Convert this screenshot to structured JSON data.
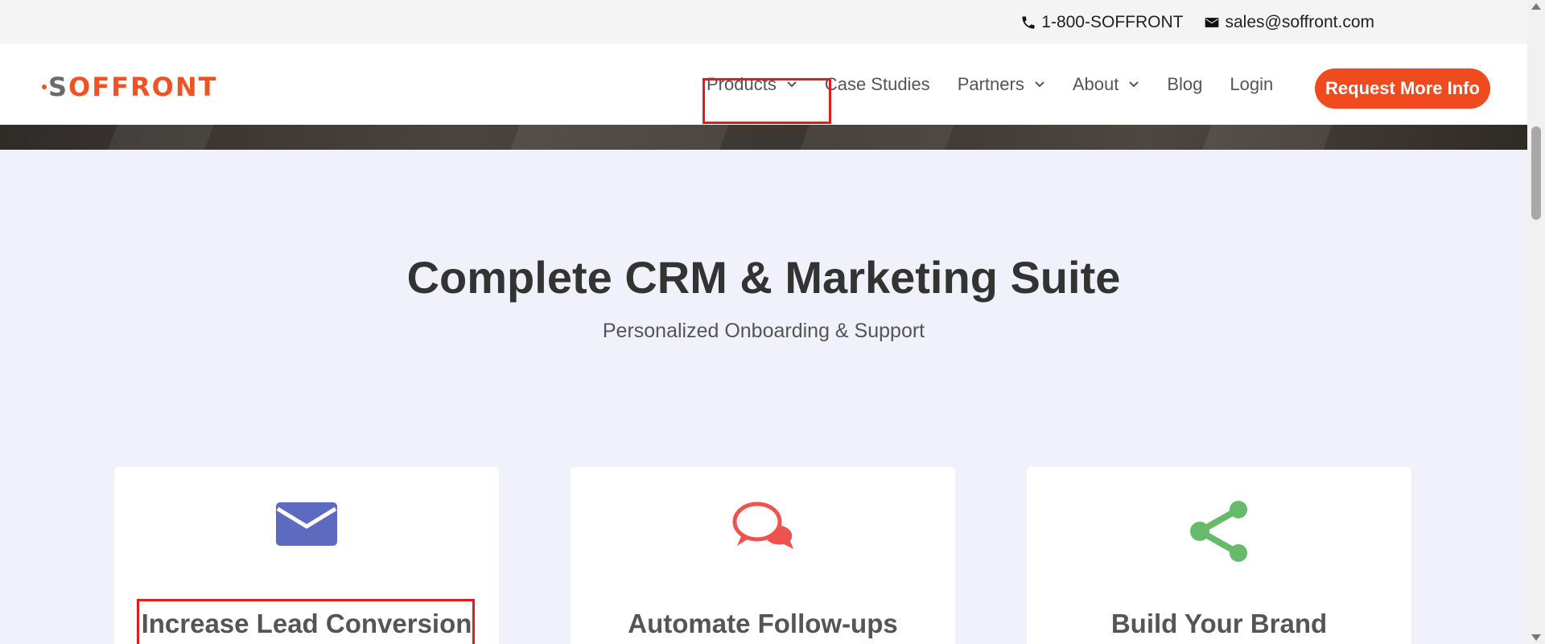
{
  "topbar": {
    "phone": "1-800-SOFFRONT",
    "email": "sales@soffront.com",
    "icons": [
      "phone-icon",
      "envelope-icon"
    ]
  },
  "brand": {
    "logo_text": "SOFFRONT",
    "logo_first": "S",
    "logo_rest": "OFFRONT",
    "color": "#f05323"
  },
  "nav": {
    "items": [
      {
        "label": "Products",
        "has_dropdown": true
      },
      {
        "label": "Case Studies",
        "has_dropdown": false
      },
      {
        "label": "Partners",
        "has_dropdown": true
      },
      {
        "label": "About",
        "has_dropdown": true
      },
      {
        "label": "Blog",
        "has_dropdown": false
      },
      {
        "label": "Login",
        "has_dropdown": false
      }
    ],
    "cta_label": "Request More Info",
    "cta_color": "#f04b1e"
  },
  "hero": {
    "title": "Complete CRM & Marketing Suite",
    "subtitle": "Personalized Onboarding & Support"
  },
  "features": [
    {
      "title": "Increase Lead Conversion",
      "icon": "envelope-icon",
      "color": "#5c6bc0"
    },
    {
      "title": "Automate Follow-ups",
      "icon": "chat-bubbles-icon",
      "color": "#ef5350"
    },
    {
      "title": "Build Your Brand",
      "icon": "share-icon",
      "color": "#66bb6a"
    }
  ],
  "highlight_color": "#e21b1b"
}
